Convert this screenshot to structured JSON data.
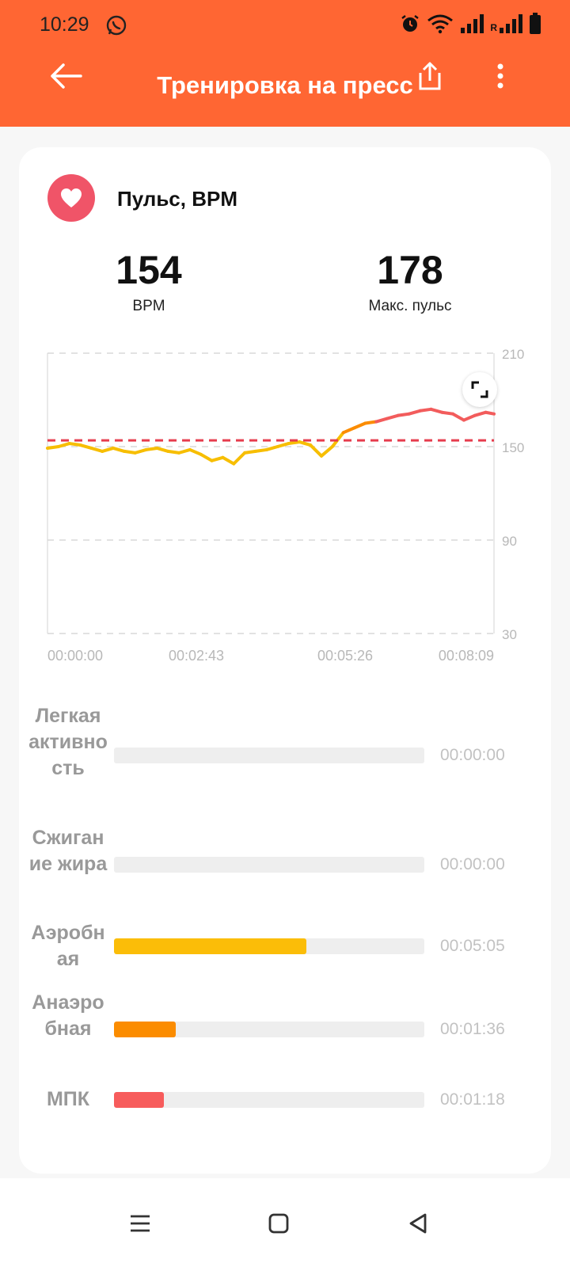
{
  "status_bar": {
    "time": "10:29",
    "icons": [
      "whatsapp-icon",
      "alarm-icon",
      "wifi-icon",
      "signal-icon",
      "signal-roaming-icon",
      "battery-icon"
    ],
    "roaming_label": "R"
  },
  "header": {
    "title": "Тренировка на пресс",
    "background_color": "#ff6633"
  },
  "heart_rate": {
    "title": "Пульс, BPM",
    "current_value": "154",
    "current_label": "BPM",
    "max_value": "178",
    "max_label": "Макс. пульс",
    "icon_color": "#f05468"
  },
  "chart_data": {
    "type": "line",
    "xlabel": "",
    "ylabel": "",
    "x_ticks": [
      "00:00:00",
      "00:02:43",
      "00:05:26",
      "00:08:09"
    ],
    "y_ticks": [
      "210",
      "150",
      "90",
      "30"
    ],
    "ylim": [
      30,
      210
    ],
    "x_range_seconds": [
      0,
      489
    ],
    "reference_line": 154,
    "grid": true,
    "series": [
      {
        "x": [
          0,
          12,
          24,
          36,
          48,
          60,
          72,
          84,
          96,
          108,
          120,
          132,
          144,
          156,
          168,
          180,
          192,
          204,
          216,
          228,
          240,
          252,
          264,
          276,
          288,
          300,
          312,
          324,
          336,
          348,
          360,
          372,
          384,
          396,
          408,
          420,
          432,
          444,
          456,
          468,
          480,
          489
        ],
        "y": [
          149,
          150,
          152,
          151,
          149,
          147,
          149,
          147,
          146,
          148,
          149,
          147,
          146,
          148,
          145,
          141,
          143,
          139,
          146,
          147,
          148,
          150,
          152,
          153,
          151,
          144,
          150,
          159,
          162,
          165,
          166,
          168,
          170,
          171,
          173,
          174,
          172,
          171,
          167,
          170,
          172,
          171
        ]
      }
    ],
    "colors": {
      "low": "#f7be00",
      "mid": "#fb8c00",
      "high": "#f25c5c",
      "reference": "#e63c4d"
    }
  },
  "zones": [
    {
      "label": "Легкая активность",
      "time": "00:00:00",
      "fraction": 0.0,
      "color": "#f7be00"
    },
    {
      "label": "Сжигание жира",
      "time": "00:00:00",
      "fraction": 0.0,
      "color": "#f7be00"
    },
    {
      "label": "Аэробная",
      "time": "00:05:05",
      "fraction": 0.62,
      "color": "#fbbd08"
    },
    {
      "label": "Анаэробная",
      "time": "00:01:36",
      "fraction": 0.2,
      "color": "#fb8c00"
    },
    {
      "label": "МПК",
      "time": "00:01:18",
      "fraction": 0.16,
      "color": "#f75c5c"
    }
  ]
}
